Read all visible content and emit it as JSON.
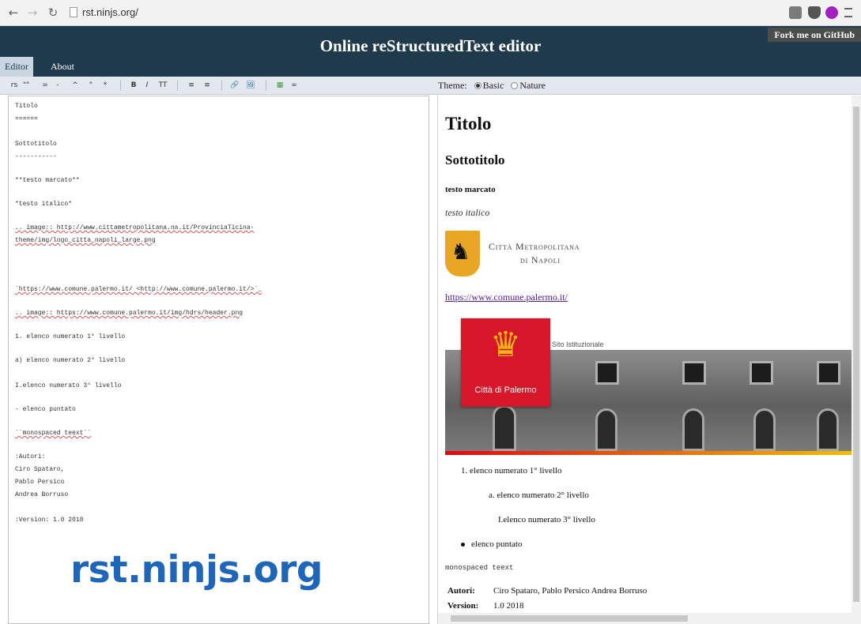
{
  "browser": {
    "url": "rst.ninjs.org/"
  },
  "header": {
    "title": "Online reStructuredText editor",
    "fork_ribbon": "Fork me on GitHub",
    "tabs": [
      {
        "label": "Editor",
        "active": true
      },
      {
        "label": "About",
        "active": false
      }
    ]
  },
  "toolbar": {
    "format_buttons": [
      "rs",
      "\"\"",
      "=",
      "-",
      "^",
      "\"",
      "*",
      "B",
      "I",
      "TT",
      "≡",
      "≡",
      "🔗",
      "🖼",
      "▦",
      "∞"
    ],
    "theme_label": "Theme:",
    "theme_options": [
      {
        "label": "Basic",
        "selected": true
      },
      {
        "label": "Nature",
        "selected": false
      }
    ]
  },
  "editor": {
    "lines": [
      "Titolo",
      "======",
      "Sottotitolo",
      "-----------",
      "**testo marcato**",
      "*testo italico*",
      ".. image:: http://www.cittametropolitana.na.it/ProvinciaTicina-",
      "theme/img/logo_citta_napoli_large.png",
      "`https://www.comune.palermo.it/ <http://www.comune.palermo.it/>`_",
      ".. image:: https://www.comune.palermo.it/img/hdrs/header.png",
      "1. elenco numerato 1° livello",
      " a) elenco numerato 2° livello",
      "  I.elenco numerato 3° livello",
      "- elenco puntato",
      "``monospaced teext``",
      ":Autori:",
      "    Ciro Spataro,",
      "    Pablo Persico",
      "    Andrea Borruso",
      ":Version: 1.0 2018"
    ],
    "watermark": "rst.ninjs.org"
  },
  "preview": {
    "h1": "Titolo",
    "h2": "Sottotitolo",
    "strong": "testo marcato",
    "em": "testo italico",
    "napoli_logo_text_line1": "Città Metropolitana",
    "napoli_logo_text_line2": "di Napoli",
    "link": "https://www.comune.palermo.it/",
    "palermo_badge_name": "Città di Palermo",
    "palermo_subtitle": "Sito Istituzionale",
    "ol_level1": "1. elenco numerato 1° livello",
    "ol_level2": "a. elenco numerato 2° livello",
    "ol_level3": "I.elenco numerato 3° livello",
    "ul_item": "elenco puntato",
    "monospace": "monospaced teext",
    "authors_label": "Autori:",
    "authors_value": "Ciro Spataro, Pablo Persico Andrea Borruso",
    "version_label": "Version:",
    "version_value": "1.0 2018"
  },
  "colors": {
    "header_bg": "#1f3a4b",
    "watermark": "#1f66b8",
    "palermo_red": "#d6172a",
    "napoli_gold": "#e8a624"
  }
}
